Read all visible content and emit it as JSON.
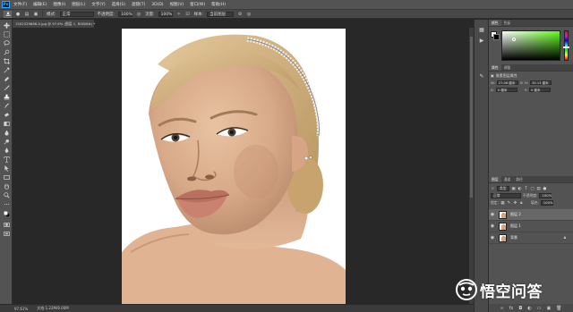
{
  "app": {
    "logo": "Ps"
  },
  "menubar": {
    "items": [
      {
        "label": "文件(F)"
      },
      {
        "label": "编辑(E)"
      },
      {
        "label": "图像(I)"
      },
      {
        "label": "图层(L)"
      },
      {
        "label": "文字(Y)"
      },
      {
        "label": "选择(S)"
      },
      {
        "label": "滤镜(T)"
      },
      {
        "label": "3D(D)"
      },
      {
        "label": "视图(V)"
      },
      {
        "label": "窗口(W)"
      },
      {
        "label": "帮助(H)"
      }
    ]
  },
  "optionsbar": {
    "mode_label": "模式:",
    "mode_value": "正常",
    "opacity_label": "不透明度:",
    "opacity_value": "100%",
    "flow_label": "流量:",
    "flow_value": "100%",
    "sample_label": "样本:",
    "sample_value": "当前图层"
  },
  "document": {
    "tab_title": "1502329886-0.jpg @ 97.6% (图层 1, RGB/8#) *"
  },
  "statusbar": {
    "zoom": "97.61%",
    "doc_info": "文档:1.22M/6.00M"
  },
  "color_panel": {
    "tabs": [
      {
        "label": "颜色"
      },
      {
        "label": "色板"
      }
    ],
    "foreground": "#ffffff",
    "background": "#000000",
    "hue_color": "#62ff1c"
  },
  "properties_panel": {
    "tabs": [
      {
        "label": "属性"
      },
      {
        "label": "调整"
      }
    ],
    "title": "像素图层属性",
    "w_label": "W:",
    "w_value": "27.06 厘米",
    "h_label": "H:",
    "h_value": "35.13 厘米",
    "x_label": "X:",
    "x_value": "0 厘米",
    "y_label": "Y:",
    "y_value": "0 厘米"
  },
  "layers_panel": {
    "tabs": [
      {
        "label": "图层"
      },
      {
        "label": "通道"
      },
      {
        "label": "路径"
      }
    ],
    "kind_label": "类型",
    "blend_mode": "正常",
    "opacity_label": "不透明度:",
    "opacity_value": "100%",
    "lock_label": "锁定:",
    "fill_label": "填充:",
    "fill_value": "100%",
    "layers": [
      {
        "name": "图层 2",
        "visible": true,
        "selected": true
      },
      {
        "name": "图层 1",
        "visible": true,
        "selected": false
      },
      {
        "name": "背景",
        "visible": true,
        "selected": false,
        "locked": true
      }
    ]
  },
  "watermark": {
    "text": "悟空问答"
  }
}
